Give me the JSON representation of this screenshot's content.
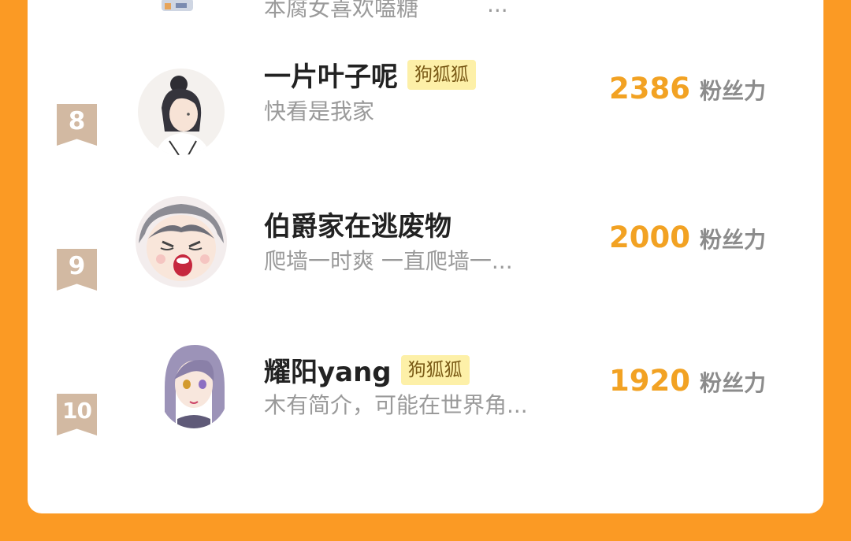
{
  "list": {
    "previous_row": {
      "bio": "本腐女喜欢嗑糖",
      "ellipsis": "..."
    },
    "rows": [
      {
        "rank": "8",
        "name": "一片叶子呢",
        "tag": "狗狐狐",
        "bio": "快看是我家",
        "count": "2386",
        "unit": "粉丝力"
      },
      {
        "rank": "9",
        "name": "伯爵家在逃废物",
        "tag": "",
        "bio": "爬墙一时爽 一直爬墙一...",
        "count": "2000",
        "unit": "粉丝力"
      },
      {
        "rank": "10",
        "name": "耀阳yang",
        "tag": "狗狐狐",
        "bio": "木有简介，可能在世界角...",
        "count": "1920",
        "unit": "粉丝力"
      }
    ]
  },
  "colors": {
    "background": "#fb9a24",
    "rank_badge": "#d2b9a2",
    "count": "#f2a223",
    "tag_bg": "#fdf0a8"
  },
  "icons": [
    "rank-ribbon-icon"
  ]
}
